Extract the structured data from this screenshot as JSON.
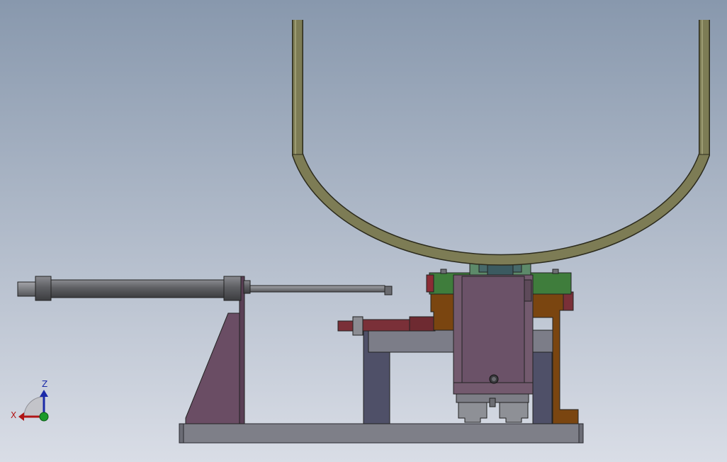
{
  "viewport": {
    "background_top": "#8898ad",
    "background_bottom": "#d9dde6"
  },
  "triad": {
    "x_label": "X",
    "z_label": "Z",
    "x_color": "#b01515",
    "z_color": "#1b2aa8",
    "y_color": "#1a9a2a"
  },
  "parts": {
    "pipe_color": "#7d7c55",
    "cylinder_color": "#5e5f63",
    "bracket_color": "#6a4d64",
    "base_color": "#7e7f88",
    "frame_color": "#4f5068",
    "brown_color": "#7a4510",
    "green_color": "#3f7d3c",
    "red_color": "#7a3038",
    "mauve_color": "#735a6e",
    "rail_color": "#8e9096"
  }
}
